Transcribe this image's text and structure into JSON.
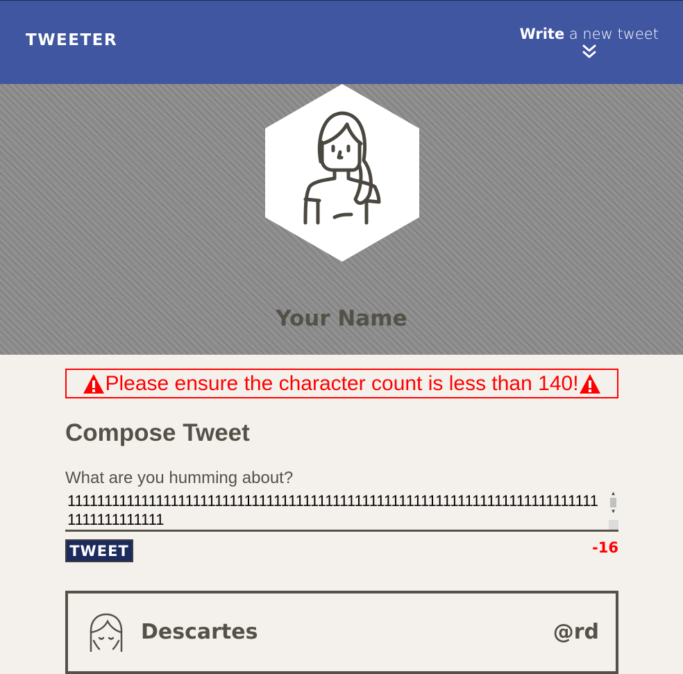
{
  "nav": {
    "brand": "TWEETER",
    "compose_strong": "Write",
    "compose_light": " a new tweet",
    "toggle_icon": "double-chevron-down-icon"
  },
  "hero": {
    "avatar_icon": "woman-avatar-icon",
    "name": "Your Name"
  },
  "error": {
    "message": "Please ensure the character count is less than 140!",
    "icon": "warning-icon",
    "color": "#ff0000"
  },
  "compose": {
    "title": "Compose Tweet",
    "label": "What are you humming about?",
    "text_value": "1111111111111111111111111111111111111111111111111111111111111111111111111111111111111",
    "button_label": "TWEET",
    "counter": "-16"
  },
  "tweets": [
    {
      "name": "Descartes",
      "handle": "@rd",
      "avatar_icon": "man-avatar-icon"
    }
  ],
  "colors": {
    "nav_bg": "#4056a1",
    "page_bg": "#f4f1ec",
    "text": "#545149",
    "button_bg": "#1d2a5e",
    "error": "#ff0000"
  }
}
